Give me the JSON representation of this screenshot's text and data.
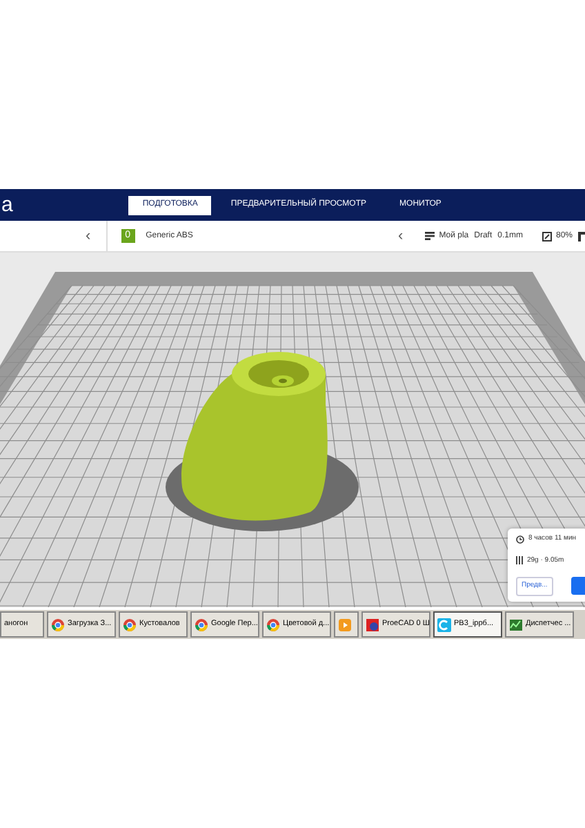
{
  "app": {
    "logo_text": "a"
  },
  "stages": [
    {
      "label": "ПОДГОТОВКА",
      "selected": true
    },
    {
      "label": "ПРЕДВАРИТЕЛЬНЫЙ ПРОСМОТР",
      "selected": false
    },
    {
      "label": "МОНИТОР",
      "selected": false
    }
  ],
  "toolbar": {
    "left_chevron": "‹",
    "material_badge": "0",
    "material": "Generic ABS",
    "right_chevron": "‹",
    "profile": "Мой pla",
    "quality": "Draft",
    "layer": "0.1mm",
    "infill": "80%"
  },
  "estimate": {
    "time": "8 часов 11 мин",
    "material": "29g · 9.05m",
    "preview_button": "Предв..."
  },
  "taskbar": [
    {
      "kind": "plain",
      "label": "аногон",
      "selected": false
    },
    {
      "kind": "chrome",
      "label": "Загрузка З...",
      "selected": false
    },
    {
      "kind": "chrome",
      "label": "Кустовалов",
      "selected": false
    },
    {
      "kind": "chrome",
      "label": "Google Пер...",
      "selected": false
    },
    {
      "kind": "chrome",
      "label": "Цветовой д...",
      "selected": false
    },
    {
      "kind": "media",
      "selected": false
    },
    {
      "kind": "cad",
      "label": "ProeCAD 0 Ш",
      "selected": false
    },
    {
      "kind": "cura",
      "label": "PB3_ippб...",
      "selected": true
    },
    {
      "kind": "monitor",
      "label": "Диспетчес ...",
      "selected": false
    }
  ]
}
